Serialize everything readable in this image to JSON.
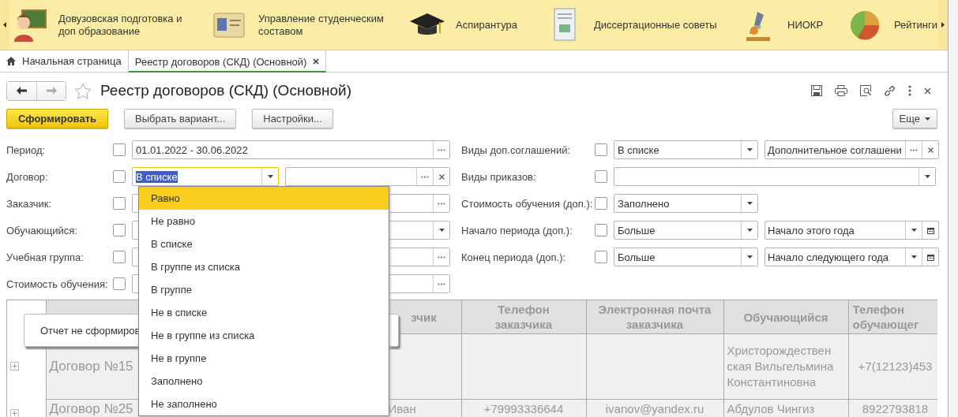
{
  "sections": {
    "items": [
      {
        "label": "Довузовская подготовка и доп образование"
      },
      {
        "label": "Управление студенческим составом"
      },
      {
        "label": "Аспирантура"
      },
      {
        "label": "Диссертационные советы"
      },
      {
        "label": "НИОКР"
      },
      {
        "label": "Рейтинги"
      }
    ]
  },
  "tabs": [
    {
      "label": "Начальная страница",
      "selected": false,
      "kind": "home"
    },
    {
      "label": "Реестр договоров (СКД) (Основной)",
      "selected": true,
      "kind": "document"
    }
  ],
  "form": {
    "title": "Реестр договоров (СКД) (Основной)",
    "favorite": false,
    "back_disabled": false,
    "forward_disabled": true,
    "buttons": [
      {
        "label": "Сформировать",
        "kind": "primary"
      },
      {
        "label": "Выбрать вариант...",
        "kind": "normal"
      },
      {
        "label": "Настройки...",
        "kind": "normal"
      }
    ],
    "more_button": "Еще"
  },
  "filters_left": [
    {
      "label": "Период:",
      "checked": false,
      "kind": "value_choose",
      "value": "01.01.2022 - 30.06.2022"
    },
    {
      "label": "Договор:",
      "checked": false,
      "kind": "condition_value_choose_clear",
      "condition": "В списке",
      "focused": true
    },
    {
      "label": "Заказчик:",
      "checked": false,
      "kind": "value_choose"
    },
    {
      "label": "Обучающийся:",
      "checked": false,
      "kind": "value_dropdown"
    },
    {
      "label": "Учебная группа:",
      "checked": false,
      "kind": "value_choose"
    },
    {
      "label": "Стоимость обучения:",
      "checked": false,
      "kind": "value_choose"
    }
  ],
  "filters_right": [
    {
      "label": "Виды доп.соглашений:",
      "checked": false,
      "kind": "condition_value_choose_clear",
      "condition": "В списке",
      "focused": false,
      "value": "Дополнительное соглашени"
    },
    {
      "label": "Виды приказов:",
      "checked": false,
      "kind": "value_dropdown"
    },
    {
      "label": "Стоимость обучения (доп.):",
      "checked": false,
      "kind": "condition",
      "condition": "Заполнено",
      "focused": false
    },
    {
      "label": "Начало периода (доп.):",
      "checked": false,
      "kind": "condition_value_dropdown_calendar",
      "condition": "Больше",
      "focused": false,
      "value": "Начало этого года"
    },
    {
      "label": "Конец периода (доп.):",
      "checked": false,
      "kind": "condition_value_dropdown_calendar",
      "condition": "Больше",
      "focused": false,
      "value": "Начало следующего года"
    }
  ],
  "condition_menu": {
    "options": [
      {
        "label": "Равно",
        "selected": true
      },
      {
        "label": "Не равно",
        "selected": false
      },
      {
        "label": "В списке",
        "selected": false
      },
      {
        "label": "В группе из списка",
        "selected": false
      },
      {
        "label": "В группе",
        "selected": false
      },
      {
        "label": "Не в списке",
        "selected": false
      },
      {
        "label": "Не в группе из списка",
        "selected": false
      },
      {
        "label": "Не в группе",
        "selected": false
      },
      {
        "label": "Заполнено",
        "selected": false
      },
      {
        "label": "Не заполнено",
        "selected": false
      }
    ]
  },
  "message": "Отчет не сформиров",
  "table": {
    "columns": [
      "",
      "зчик",
      "Телефон заказчика",
      "Электронная почта заказчика",
      "Обучающийся",
      "Телефон обучающег"
    ],
    "rows": [
      {
        "expanded": false,
        "cells": [
          "Договор №15",
          "",
          "",
          "",
          "Христорождествен ская Вильгельмина Константиновна",
          "+7(12123)453"
        ]
      },
      {
        "expanded": false,
        "cells": [
          "Договор №25",
          "Иван",
          "+79993336644",
          "ivanov@yandex.ru",
          "Абдулов Чингиз",
          "8922793818"
        ]
      }
    ]
  }
}
